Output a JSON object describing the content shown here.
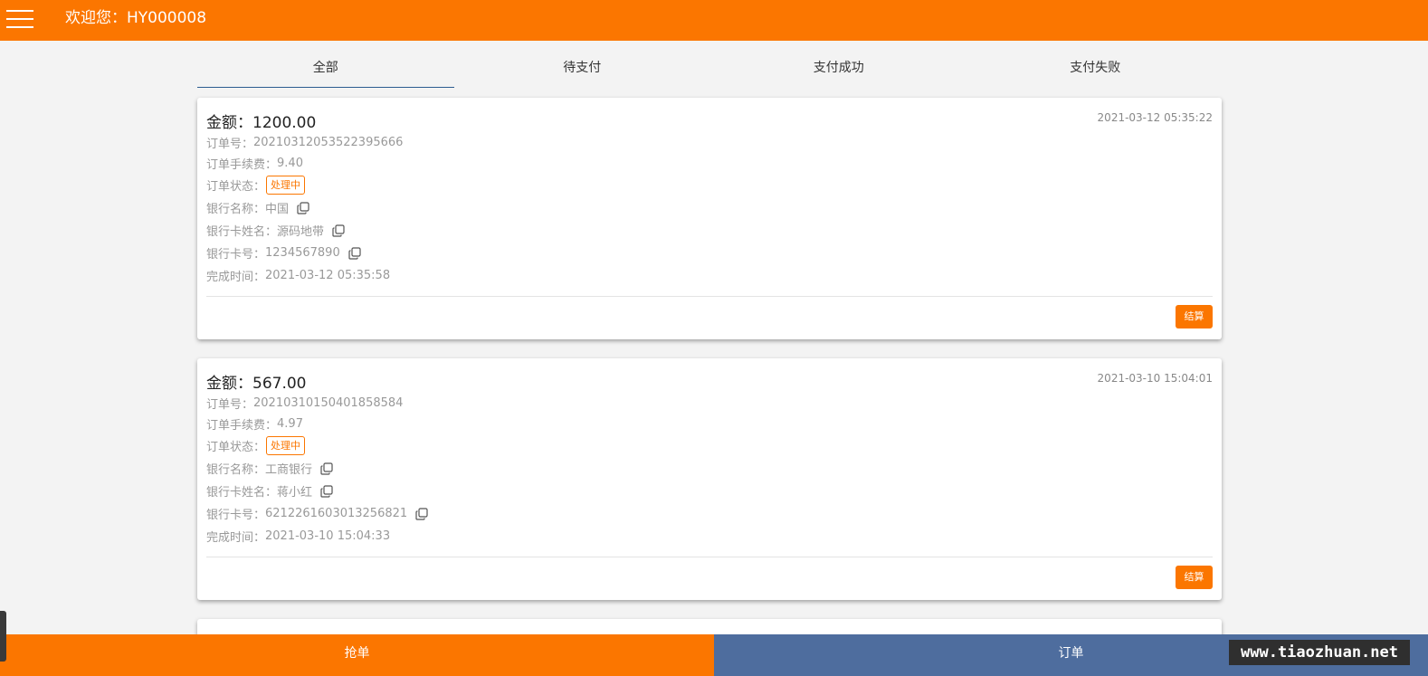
{
  "header": {
    "welcome": "欢迎您：HY000008"
  },
  "tabs": [
    {
      "label": "全部",
      "active": true
    },
    {
      "label": "待支付",
      "active": false
    },
    {
      "label": "支付成功",
      "active": false
    },
    {
      "label": "支付失败",
      "active": false
    }
  ],
  "orders": [
    {
      "amount": "金额：1200.00",
      "created_time": "2021-03-12 05:35:22",
      "order_no_label": "订单号：",
      "order_no": "20210312053522395666",
      "fee_label": "订单手续费：",
      "fee": "9.40",
      "status_label": "订单状态：",
      "status": "处理中",
      "bank_name_label": "银行名称：",
      "bank_name": "中国",
      "card_holder_label": "银行卡姓名：",
      "card_holder": "源码地带",
      "card_no_label": "银行卡号：",
      "card_no": "1234567890",
      "finish_time_label": "完成时间：",
      "finish_time": "2021-03-12 05:35:58",
      "settle_label": "结算"
    },
    {
      "amount": "金额：567.00",
      "created_time": "2021-03-10 15:04:01",
      "order_no_label": "订单号：",
      "order_no": "20210310150401858584",
      "fee_label": "订单手续费：",
      "fee": "4.97",
      "status_label": "订单状态：",
      "status": "处理中",
      "bank_name_label": "银行名称：",
      "bank_name": "工商银行",
      "card_holder_label": "银行卡姓名：",
      "card_holder": "蒋小红",
      "card_no_label": "银行卡号：",
      "card_no": "6212261603013256821",
      "finish_time_label": "完成时间：",
      "finish_time": "2021-03-10 15:04:33",
      "settle_label": "结算"
    }
  ],
  "bottom_nav": {
    "grab_label": "抢单",
    "orders_label": "订单"
  },
  "watermark": "www.tiaozhuan.net",
  "colors": {
    "accent": "#fb7600",
    "nav_secondary": "#4e6d9e",
    "background": "#f3f3f3"
  }
}
